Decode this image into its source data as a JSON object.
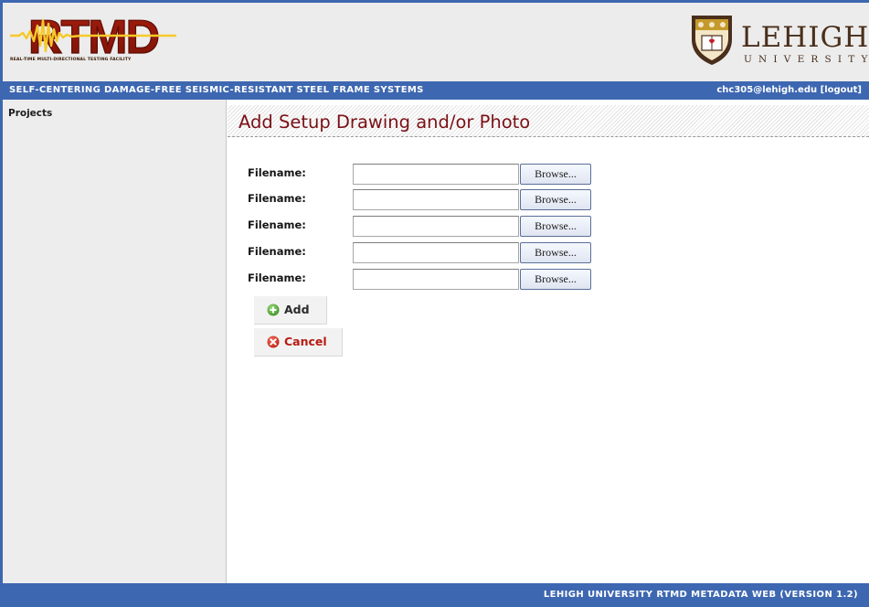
{
  "header": {
    "rtmd_logo": {
      "wordmark": "RTMD",
      "caption": "REAL-TIME MULTI-DIRECTIONAL TESTING FACILITY"
    },
    "lehigh_logo": {
      "word": "LEHIGH",
      "sub": "UNIVERSITY"
    }
  },
  "navbar": {
    "project_title": "SELF-CENTERING DAMAGE-FREE SEISMIC-RESISTANT STEEL FRAME SYSTEMS",
    "user_email": "chc305@lehigh.edu",
    "logout_open": "[",
    "logout_label": "logout",
    "logout_close": "]"
  },
  "sidebar": {
    "items": [
      {
        "label": "Projects"
      }
    ]
  },
  "main": {
    "title": "Add Setup Drawing and/or Photo",
    "file_rows": [
      {
        "label": "Filename:",
        "value": "",
        "browse_label": "Browse..."
      },
      {
        "label": "Filename:",
        "value": "",
        "browse_label": "Browse..."
      },
      {
        "label": "Filename:",
        "value": "",
        "browse_label": "Browse..."
      },
      {
        "label": "Filename:",
        "value": "",
        "browse_label": "Browse..."
      },
      {
        "label": "Filename:",
        "value": "",
        "browse_label": "Browse..."
      }
    ],
    "add_button": {
      "label": "Add",
      "icon": "plus-circle-icon"
    },
    "cancel_button": {
      "label": "Cancel",
      "icon": "x-circle-icon"
    }
  },
  "footer": {
    "text": "LEHIGH UNIVERSITY RTMD METADATA WEB (VERSION 1.2)"
  },
  "colors": {
    "accent_blue": "#3d67b1",
    "title_red": "#7a1015",
    "cancel_red": "#b71a12",
    "add_green": "#4aa233",
    "sidebar_gray": "#ededed"
  }
}
